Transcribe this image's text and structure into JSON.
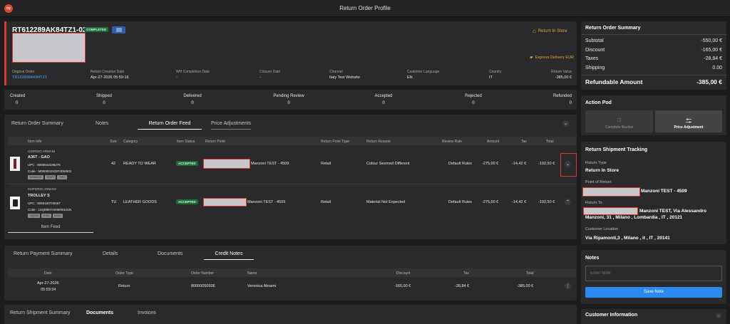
{
  "app": {
    "title": "Return Order Profile",
    "logo": "ny"
  },
  "order": {
    "number": "RT612289AK84TZ1-02",
    "status": "COMPLETED",
    "return_mode": "Return In Store",
    "delivery": "Express Delivery EUR"
  },
  "info": [
    {
      "label": "Original Order",
      "value": "TR122898AK84TZ1"
    },
    {
      "label": "Return Creation Date",
      "value": "Apr-27-2026 05:59:16"
    },
    {
      "label": "WH Completion Date",
      "value": "-"
    },
    {
      "label": "Closure Date",
      "value": "-"
    },
    {
      "label": "Channel",
      "value": "Italy Test Website"
    },
    {
      "label": "Customer Language",
      "value": "EN"
    },
    {
      "label": "Country",
      "value": "IT"
    },
    {
      "label": "Return Value",
      "value": "-385,00 €"
    }
  ],
  "stats": [
    {
      "label": "Created",
      "value": "0"
    },
    {
      "label": "Shipped",
      "value": "0"
    },
    {
      "label": "Delivered",
      "value": "0"
    },
    {
      "label": "Pending Review",
      "value": "0"
    },
    {
      "label": "Accepted",
      "value": "0"
    },
    {
      "label": "Rejected",
      "value": "0"
    },
    {
      "label": "Refunded",
      "value": "0"
    }
  ],
  "feed_tabs": [
    "Return Order Summary",
    "Notes",
    "Return Order Feed",
    "Price Adjustments"
  ],
  "feed_headers": [
    "Item Info",
    "Size",
    "Category",
    "Item Status",
    "Return Point",
    "Return Point Type",
    "Return Reason",
    "Review Rule",
    "Amount",
    "Tax",
    "Total"
  ],
  "feed_rows": [
    {
      "brand": "GIORGIO ARMANI",
      "name": "A36T - GAO",
      "upc": "UPC : 8056643198276",
      "code": "Code : M000001N22F2D9/501",
      "chips": [
        "3MHNK0ZL",
        "TEAP3",
        "TSEK"
      ],
      "size": "42",
      "category": "READY TO WEAR",
      "status": "ACCEPTED",
      "point": "Manzoni TEST - 4509",
      "type": "Retail",
      "reason": "Colour Seemed Different",
      "rule": "Default Rules",
      "amount": "-275,00 €",
      "tax": "-14,42 €",
      "total": "-192,50 €"
    },
    {
      "brand": "EMPORIO ARMANI",
      "name": "TROLLEY S",
      "upc": "UPC : 8055160709467",
      "code": "Code : 14Q095YH/49I/00101N",
      "chips": [
        "Y4Q095",
        "YH51I",
        "8X052"
      ],
      "size": "TU",
      "category": "LEATHER GOODS",
      "status": "ACCEPTED",
      "point": "Manzoni TEST - 4509",
      "type": "Retail",
      "reason": "Material Not Expected",
      "rule": "Default Rules",
      "amount": "-275,00 €",
      "tax": "-14,42 €",
      "total": "-192,50 €"
    }
  ],
  "item_feed_label": "Item Feed",
  "pay_tabs": [
    "Return Payment Summary",
    "Details",
    "Documents",
    "Credit Notes"
  ],
  "pay_headers": [
    "Date",
    "Order Type",
    "Order Number",
    "Name",
    "Discount",
    "Tax",
    "Total"
  ],
  "pay_row": {
    "date1": "Apr-27-2026",
    "date2": "05:59:34",
    "type": "Return",
    "number": "80000050936",
    "name": "Veronica Abrami",
    "discount": "-165,00 €",
    "tax": "-28,84 €",
    "total": "-385,00 €"
  },
  "ship_tabs": [
    "Return Shipment Summary",
    "Documents",
    "Invoices"
  ],
  "summary": {
    "title": "Return Order Summary",
    "rows": [
      {
        "label": "Subtotal",
        "value": "-550,00 €"
      },
      {
        "label": "Discount",
        "value": "-165,00 €"
      },
      {
        "label": "Taxes",
        "value": "-28,84 €"
      },
      {
        "label": "Shipping",
        "value": "0.00"
      }
    ],
    "refund_label": "Refundable Amount",
    "refund_value": "-385,00 €"
  },
  "action_pod": {
    "title": "Action Pod",
    "complete": "Complete Review",
    "price": "Price Adjustment"
  },
  "tracking": {
    "title": "Return Shipment Tracking",
    "type_label": "Return Type",
    "type_value": "Return In Store",
    "point_label": "Point of Return",
    "point_value": "Manzoni TEST - 4509",
    "to_label": "Return To",
    "to_value1": "Manzoni TEST, Via Alessandro",
    "to_value2": "Manzoni, 31 , Milano , Lombardia , IT , 20121",
    "loc_label": "Customer Location",
    "loc_value": "Via Ripamonti,3 , Milano , it , IT , 20141"
  },
  "notes": {
    "title": "Notes",
    "placeholder": "Enter Note",
    "save": "Save Note"
  },
  "customer": {
    "title": "Customer Information"
  }
}
